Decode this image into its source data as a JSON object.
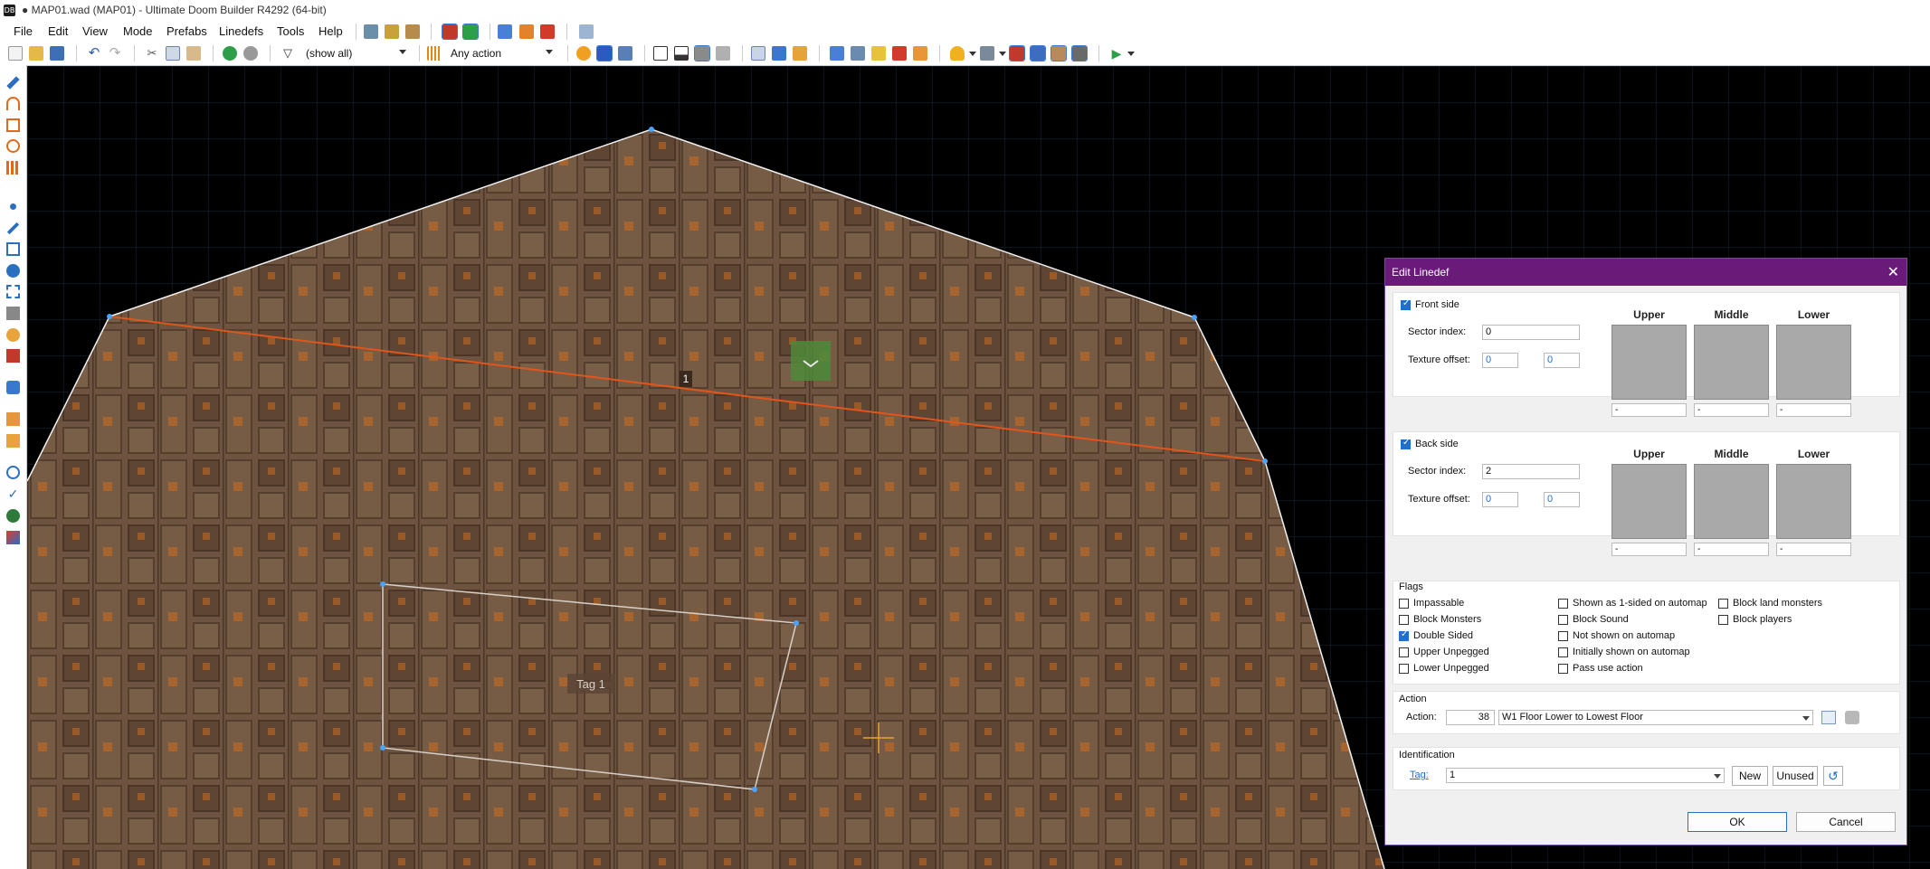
{
  "window": {
    "title": "● MAP01.wad (MAP01) - Ultimate Doom Builder R4292 (64-bit)",
    "app_icon_text": "DB"
  },
  "menu": [
    "File",
    "Edit",
    "View",
    "Mode",
    "Prefabs",
    "Linedefs",
    "Tools",
    "Help"
  ],
  "toolbar": {
    "filter_value": "(show all)",
    "action_filter_value": "Any action"
  },
  "map": {
    "linedef_label": "1",
    "sector_tag_label": "Tag 1"
  },
  "dialog": {
    "title": "Edit Linedef",
    "front": {
      "enabled_label": "Front side",
      "sector_index_label": "Sector index:",
      "sector_index": "0",
      "texture_offset_label": "Texture offset:",
      "offset_x": "0",
      "offset_y": "0",
      "columns": [
        "Upper",
        "Middle",
        "Lower"
      ],
      "textures": [
        "-",
        "-",
        "-"
      ]
    },
    "back": {
      "enabled_label": "Back side",
      "sector_index_label": "Sector index:",
      "sector_index": "2",
      "texture_offset_label": "Texture offset:",
      "offset_x": "0",
      "offset_y": "0",
      "columns": [
        "Upper",
        "Middle",
        "Lower"
      ],
      "textures": [
        "-",
        "-",
        "-"
      ]
    },
    "flags": {
      "heading": "Flags",
      "col1": [
        {
          "label": "Impassable",
          "checked": false
        },
        {
          "label": "Block Monsters",
          "checked": false
        },
        {
          "label": "Double Sided",
          "checked": true
        },
        {
          "label": "Upper Unpegged",
          "checked": false
        },
        {
          "label": "Lower Unpegged",
          "checked": false
        }
      ],
      "col2": [
        {
          "label": "Shown as 1-sided on automap",
          "checked": false
        },
        {
          "label": "Block Sound",
          "checked": false
        },
        {
          "label": "Not shown on automap",
          "checked": false
        },
        {
          "label": "Initially shown on automap",
          "checked": false
        },
        {
          "label": "Pass use action",
          "checked": false
        }
      ],
      "col3": [
        {
          "label": "Block land monsters",
          "checked": false
        },
        {
          "label": "Block players",
          "checked": false
        }
      ]
    },
    "action": {
      "heading": "Action",
      "label": "Action:",
      "number": "38",
      "value": "W1 Floor Lower to Lowest Floor"
    },
    "identification": {
      "heading": "Identification",
      "tag_label": "Tag:",
      "tag_value": "1",
      "new_label": "New",
      "unused_label": "Unused"
    },
    "ok_label": "OK",
    "cancel_label": "Cancel"
  },
  "colors": {
    "dialog_title_bg": "#6a1b7a",
    "selected_line": "#e0561a",
    "floor_brown": "#6e5440",
    "vertex": "#4aa3ff"
  }
}
